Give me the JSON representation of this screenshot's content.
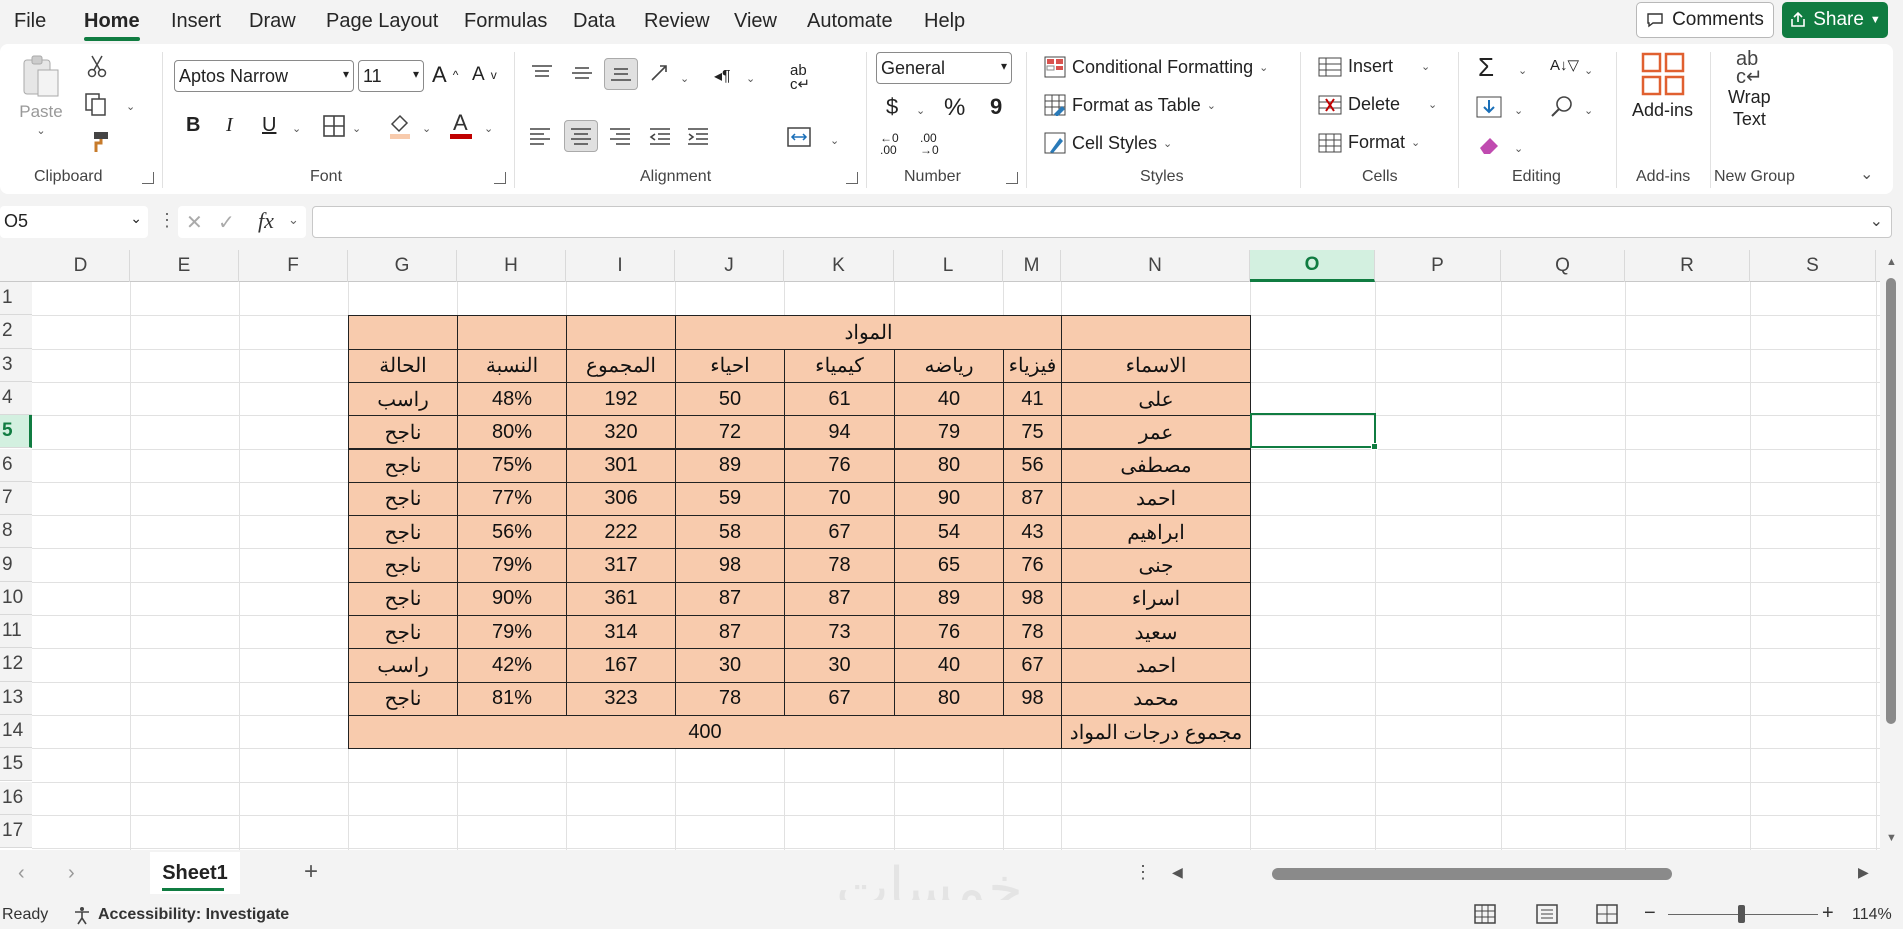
{
  "menu": {
    "items": [
      "File",
      "Home",
      "Insert",
      "Draw",
      "Page Layout",
      "Formulas",
      "Data",
      "Review",
      "View",
      "Automate",
      "Help"
    ],
    "comments": "Comments",
    "share": "Share"
  },
  "ribbon": {
    "clipboard": {
      "paste": "Paste",
      "label": "Clipboard"
    },
    "font": {
      "name": "Aptos Narrow",
      "size": "11",
      "bold": "B",
      "italic": "I",
      "underline": "U",
      "label": "Font"
    },
    "alignment": {
      "label": "Alignment"
    },
    "number": {
      "format": "General",
      "currency": "$",
      "percent": "%",
      "comma": "9",
      "inc_decimal": "←0 .00",
      "dec_decimal": ".00 →0",
      "label": "Number"
    },
    "styles": {
      "conditional": "Conditional Formatting",
      "format_table": "Format as Table",
      "cell_styles": "Cell Styles",
      "label": "Styles"
    },
    "cells": {
      "insert": "Insert",
      "delete": "Delete",
      "format": "Format",
      "label": "Cells"
    },
    "editing": {
      "label": "Editing"
    },
    "addins": {
      "button": "Add-ins",
      "label": "Add-ins"
    },
    "newgroup": {
      "button_line1": "Wrap",
      "button_line2": "Text",
      "label": "New Group"
    }
  },
  "formula_bar": {
    "name_box": "O5",
    "fx": "fx"
  },
  "grid": {
    "columns": [
      "D",
      "E",
      "F",
      "G",
      "H",
      "I",
      "J",
      "K",
      "L",
      "M",
      "N",
      "O",
      "P",
      "Q",
      "R",
      "S"
    ],
    "rows": [
      "1",
      "2",
      "3",
      "4",
      "5",
      "6",
      "7",
      "8",
      "9",
      "10",
      "11",
      "12",
      "13",
      "14",
      "15",
      "16",
      "17"
    ],
    "selected_column": "O",
    "selected_row": "5"
  },
  "table": {
    "subjects_header": "المواد",
    "headers": [
      "الحالة",
      "النسبة",
      "المجموع",
      "احياء",
      "كيمياء",
      "رياضه",
      "فيزياء",
      "الاسماء"
    ],
    "rows": [
      [
        "راسب",
        "48%",
        "192",
        "50",
        "61",
        "40",
        "41",
        "على"
      ],
      [
        "ناجح",
        "80%",
        "320",
        "72",
        "94",
        "79",
        "75",
        "عمر"
      ],
      [
        "ناجح",
        "75%",
        "301",
        "89",
        "76",
        "80",
        "56",
        "مصطفى"
      ],
      [
        "ناجح",
        "77%",
        "306",
        "59",
        "70",
        "90",
        "87",
        "احمد"
      ],
      [
        "ناجح",
        "56%",
        "222",
        "58",
        "67",
        "54",
        "43",
        "ابراهيم"
      ],
      [
        "ناجح",
        "79%",
        "317",
        "98",
        "78",
        "65",
        "76",
        "جنى"
      ],
      [
        "ناجح",
        "90%",
        "361",
        "87",
        "87",
        "89",
        "98",
        "اسراء"
      ],
      [
        "ناجح",
        "79%",
        "314",
        "87",
        "73",
        "76",
        "78",
        "سعيد"
      ],
      [
        "راسب",
        "42%",
        "167",
        "30",
        "30",
        "40",
        "67",
        "احمد"
      ],
      [
        "ناجح",
        "81%",
        "323",
        "78",
        "67",
        "80",
        "98",
        "محمد"
      ]
    ],
    "total_value": "400",
    "total_label": "مجموع درجات المواد"
  },
  "sheets": {
    "active": "Sheet1"
  },
  "status": {
    "ready": "Ready",
    "accessibility": "Accessibility: Investigate",
    "zoom": "114%"
  },
  "watermark": "خمسات"
}
